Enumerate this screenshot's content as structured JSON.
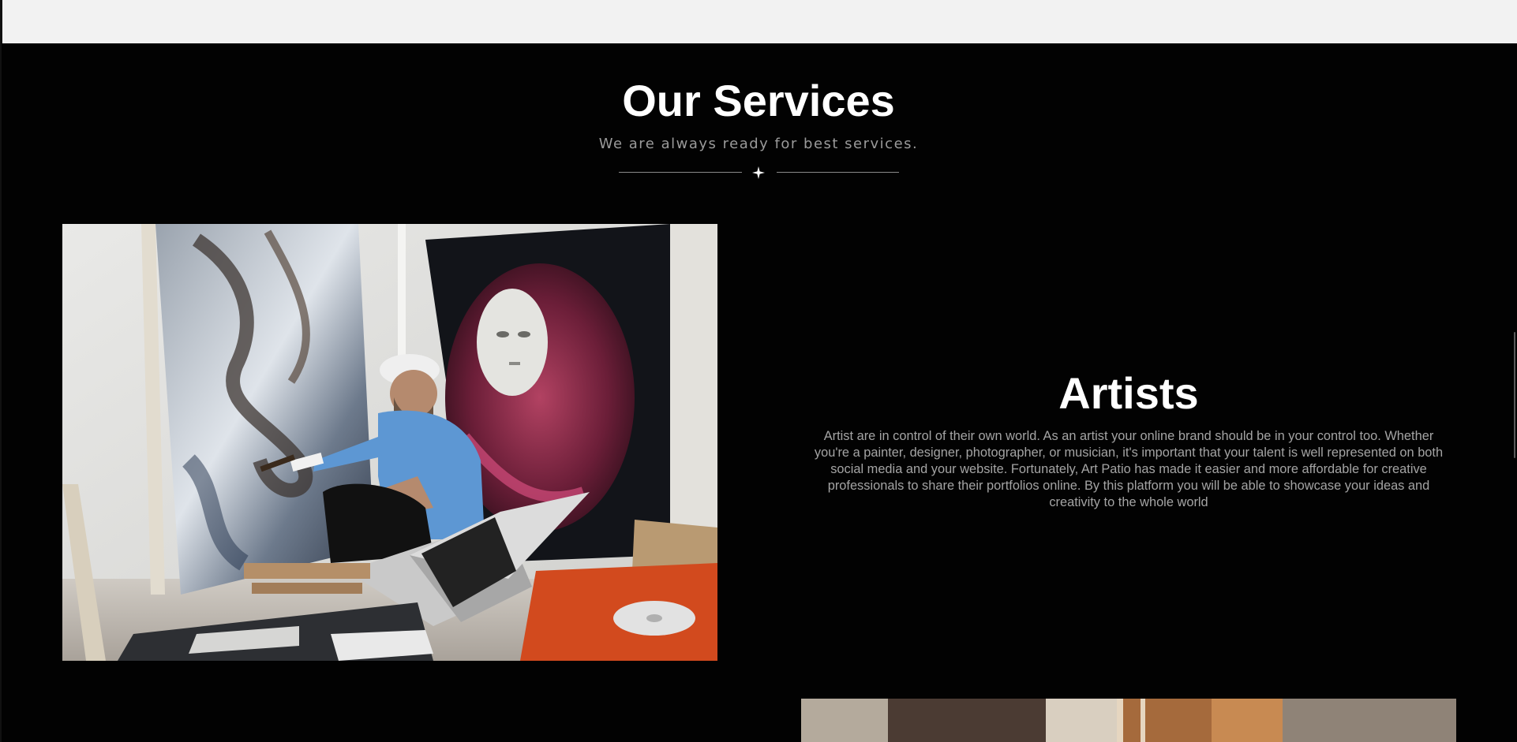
{
  "services": {
    "title": "Our Services",
    "subtitle": "We are always ready for best services."
  },
  "artists_card": {
    "title": "Artists",
    "body": "Artist are in control of their own world. As an artist your online brand should be in your control too. Whether you're a painter, designer, photographer, or musician, it's important that your talent is well represented on both social media and your website. Fortunately, Art Patio has made it easier and more affordable for creative professionals to share their portfolios online. By this platform you will be able to showcase your ideas and creativity to the whole world",
    "image_icon": "artist-painting-photo"
  },
  "next_card": {
    "image_icon": "studio-interior-photo"
  },
  "colors": {
    "background": "#020202",
    "heading": "#ffffff",
    "body_text": "#a4a4a4",
    "subtitle": "#9a9a9a",
    "top_strip": "#f2f2f2"
  }
}
